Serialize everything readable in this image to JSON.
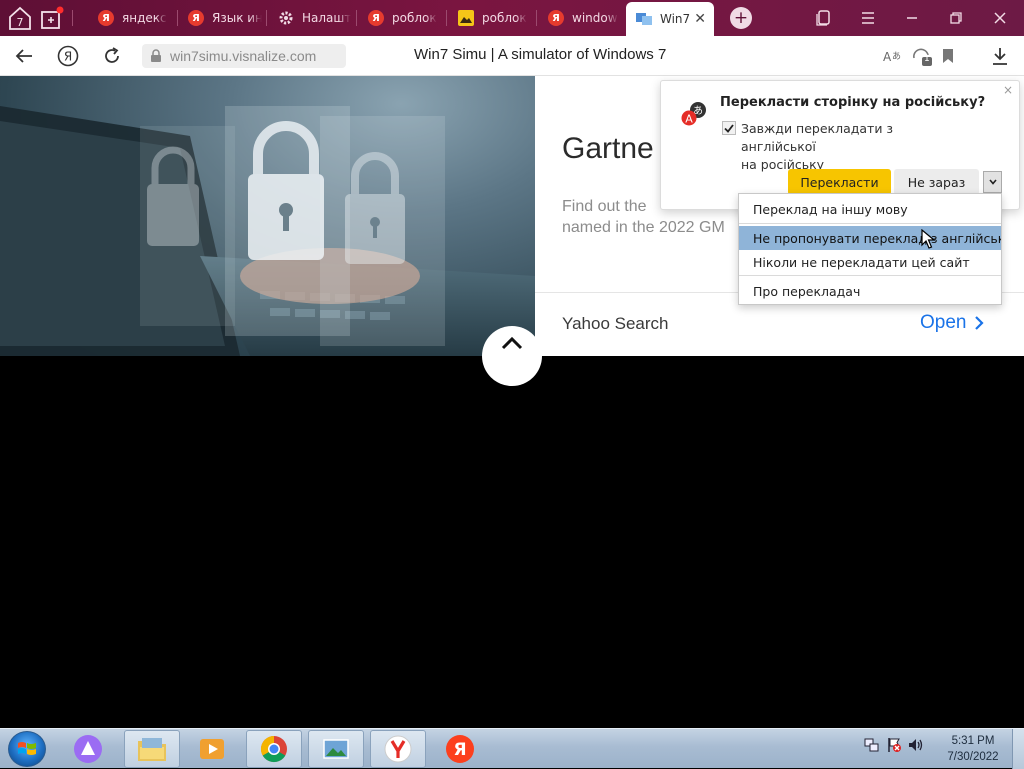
{
  "browser": {
    "sys_buttons": [
      {
        "name": "home-page",
        "label": "7"
      },
      {
        "name": "new-tab-page",
        "label": ""
      }
    ],
    "tabs": [
      {
        "label": "яндекс",
        "icon": "yandex-icon",
        "color": "#e63b2e"
      },
      {
        "label": "Язык ин",
        "icon": "yandex-icon",
        "color": "#e63b2e"
      },
      {
        "label": "Налашт",
        "icon": "gear-icon",
        "color": "#f2dce6"
      },
      {
        "label": "роблок",
        "icon": "yandex-icon",
        "color": "#e63b2e"
      },
      {
        "label": "роблок",
        "icon": "image-icon",
        "color": "#f5c518"
      },
      {
        "label": "window",
        "icon": "yandex-icon",
        "color": "#e63b2e"
      },
      {
        "label": "Win7",
        "icon": "win7-icon",
        "color": "#4b8bd6",
        "active": true
      }
    ],
    "new_tab_symbol": "+",
    "url": "win7simu.visnalize.com",
    "page_title": "Win7 Simu | A simulator of Windows 7",
    "translate_badge": "1"
  },
  "card": {
    "title": "Gartne",
    "description": "Find out the\nnamed in the 2022 GM",
    "source": "Yahoo Search",
    "open_label": "Open"
  },
  "translate_popup": {
    "title": "Перекласти сторінку на російську?",
    "checkbox_label": "Завжди перекладати з англійської\nна російську",
    "checkbox_checked": true,
    "translate_button": "Перекласти",
    "not_now_button": "Не зараз",
    "close_symbol": "×"
  },
  "translate_menu": {
    "items": [
      {
        "label": "Переклад на іншу мову",
        "highlighted": false
      },
      {
        "label": "Не пропонувати переклад з англійської",
        "highlighted": true
      },
      {
        "label": "Ніколи не перекладати цей сайт",
        "highlighted": false
      },
      {
        "label": "Про перекладач",
        "highlighted": false
      }
    ]
  },
  "taskbar": {
    "items": [
      {
        "name": "alice",
        "icon": "alice-icon"
      },
      {
        "name": "explorer",
        "icon": "folder-icon"
      },
      {
        "name": "media-player",
        "icon": "media-icon"
      },
      {
        "name": "chrome",
        "icon": "chrome-icon"
      },
      {
        "name": "photo-viewer",
        "icon": "photo-icon"
      },
      {
        "name": "yandex-browser",
        "icon": "yandex-browser-icon"
      },
      {
        "name": "yandex",
        "icon": "yandex-icon"
      }
    ],
    "clock_time": "5:31 PM",
    "clock_date": "7/30/2022"
  },
  "colors": {
    "tab_strip": "#6b1239",
    "accent_yellow": "#f7c500",
    "link_blue": "#1a73e8",
    "menu_highlight": "#8fb4d8"
  }
}
